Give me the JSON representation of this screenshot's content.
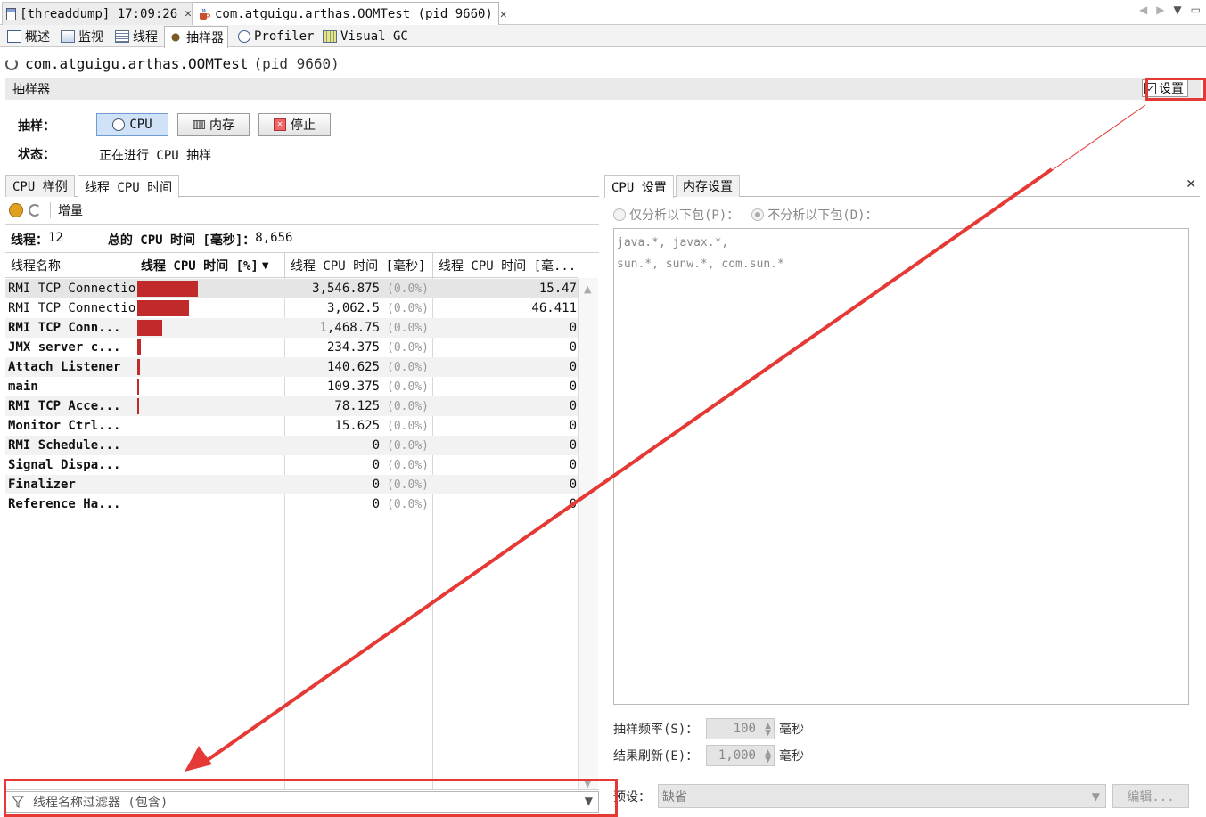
{
  "doc_tabs": [
    {
      "label": "[threaddump] 17:09:26",
      "close": "✕"
    },
    {
      "label": "com.atguigu.arthas.OOMTest (pid 9660)",
      "close": "✕"
    }
  ],
  "nav": {
    "left": "◀",
    "right": "▶",
    "menu": "▼",
    "restore": "▭"
  },
  "view_tabs": [
    "概述",
    "监视",
    "线程",
    "抽样器",
    "Profiler",
    "Visual GC"
  ],
  "app": {
    "name": "com.atguigu.arthas.OOMTest",
    "pid": "(pid 9660)"
  },
  "sampler": {
    "title": "抽样器",
    "settings_label": "设置",
    "settings_checked": true
  },
  "controls": {
    "sample_label": "抽样：",
    "cpu_button": "CPU",
    "memory_button": "内存",
    "stop_button": "停止",
    "status_label": "状态：",
    "status_value": "正在进行 CPU 抽样"
  },
  "left_panel": {
    "tabs": [
      "CPU 样例",
      "线程 CPU 时间"
    ],
    "toolbar_delta": "增量",
    "threads_label": "线程：",
    "threads_count": "12",
    "total_label": "总的 CPU 时间 [毫秒]：",
    "total_value": "8,656",
    "columns": [
      "线程名称",
      "线程 CPU 时间 [%]",
      "线程 CPU 时间 [毫秒]",
      "线程 CPU 时间 [毫..."
    ],
    "sort_indicator": "▼",
    "rows": [
      {
        "name": "RMI TCP Connection",
        "bold": false,
        "bar": 0.41,
        "ms": "3,546.875",
        "pct": "(0.0%)",
        "time": "15.47"
      },
      {
        "name": "RMI TCP Connection",
        "bold": false,
        "bar": 0.354,
        "ms": "3,062.5",
        "pct": "(0.0%)",
        "time": "46.411"
      },
      {
        "name": "RMI TCP Conn...",
        "bold": true,
        "bar": 0.17,
        "ms": "1,468.75",
        "pct": "(0.0%)",
        "time": "0"
      },
      {
        "name": "JMX server c...",
        "bold": true,
        "bar": 0.027,
        "ms": "234.375",
        "pct": "(0.0%)",
        "time": "0"
      },
      {
        "name": "Attach Listener",
        "bold": true,
        "bar": 0.016,
        "ms": "140.625",
        "pct": "(0.0%)",
        "time": "0"
      },
      {
        "name": "main",
        "bold": true,
        "bar": 0.013,
        "ms": "109.375",
        "pct": "(0.0%)",
        "time": "0"
      },
      {
        "name": "RMI TCP Acce...",
        "bold": true,
        "bar": 0.009,
        "ms": "78.125",
        "pct": "(0.0%)",
        "time": "0"
      },
      {
        "name": "Monitor Ctrl...",
        "bold": true,
        "bar": 0.0,
        "ms": "15.625",
        "pct": "(0.0%)",
        "time": "0"
      },
      {
        "name": "RMI Schedule...",
        "bold": true,
        "bar": 0.0,
        "ms": "0",
        "pct": "(0.0%)",
        "time": "0"
      },
      {
        "name": "Signal Dispa...",
        "bold": true,
        "bar": 0.0,
        "ms": "0",
        "pct": "(0.0%)",
        "time": "0"
      },
      {
        "name": "Finalizer",
        "bold": true,
        "bar": 0.0,
        "ms": "0",
        "pct": "(0.0%)",
        "time": "0"
      },
      {
        "name": "Reference Ha...",
        "bold": true,
        "bar": 0.0,
        "ms": "0",
        "pct": "(0.0%)",
        "time": "0"
      }
    ],
    "scroll_up": "▲",
    "scroll_down": "▼",
    "filter_placeholder": "线程名称过滤器 (包含)",
    "filter_dropdown": "▼"
  },
  "right_panel": {
    "tabs": [
      "CPU 设置",
      "内存设置"
    ],
    "close": "✕",
    "radio_only": "仅分析以下包(P)：",
    "radio_exclude": "不分析以下包(D)：",
    "packages": "java.*, javax.*,\nsun.*, sunw.*, com.sun.*",
    "sampling_rate_label": "抽样频率(S)：",
    "sampling_rate_value": "100",
    "refresh_label": "结果刷新(E)：",
    "refresh_value": "1,000",
    "unit_ms": "毫秒",
    "preset_label": "预设：",
    "preset_value": "缺省",
    "edit_button": "编辑..."
  },
  "colors": {
    "bar": "#c12a2a",
    "annotation": "#e53935",
    "pressed_button": "#cfe2f8"
  }
}
